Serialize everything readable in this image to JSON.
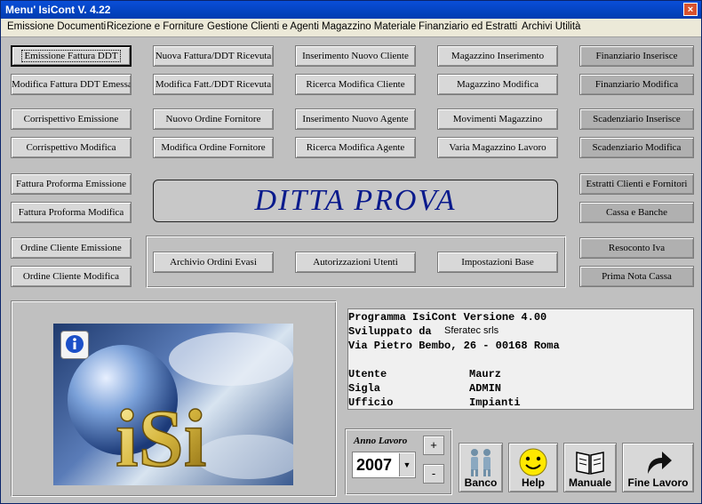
{
  "window": {
    "title": "Menu' IsiCont V. 4.22",
    "close_label": "×"
  },
  "menu": [
    "Emissione Documenti",
    "Ricezione e Forniture",
    "Gestione Clienti e Agenti",
    "Magazzino Materiale",
    "Finanziario ed Estratti",
    "Archivi Utilità"
  ],
  "buttons": {
    "emissione_fattura_ddt": "Emissione Fattura DDT",
    "modifica_fattura_ddt": "Modifica Fattura DDT Emessa",
    "corrispettivo_emissione": "Corrispettivo Emissione",
    "corrispettivo_modifica": "Corrispettivo Modifica",
    "proforma_emissione": "Fattura Proforma Emissione",
    "proforma_modifica": "Fattura Proforma Modifica",
    "ordine_cliente_emissione": "Ordine Cliente Emissione",
    "ordine_cliente_modifica": "Ordine Cliente Modifica",
    "nuova_fattura_ricevuta": "Nuova Fattura/DDT Ricevuta",
    "modifica_fatt_ricevuta": "Modifica Fatt./DDT Ricevuta",
    "nuovo_ordine_fornitore": "Nuovo Ordine Fornitore",
    "modifica_ordine_fornitore": "Modifica Ordine Fornitore",
    "inserimento_cliente": "Inserimento Nuovo Cliente",
    "ricerca_cliente": "Ricerca Modifica Cliente",
    "inserimento_agente": "Inserimento Nuovo Agente",
    "ricerca_agente": "Ricerca Modifica Agente",
    "magazzino_inserimento": "Magazzino Inserimento",
    "magazzino_modifica": "Magazzino Modifica",
    "movimenti_magazzino": "Movimenti Magazzino",
    "varia_magazzino": "Varia Magazzino Lavoro",
    "finanziario_inserisce": "Finanziario Inserisce",
    "finanziario_modifica": "Finanziario Modifica",
    "scadenziario_inserisce": "Scadenziario Inserisce",
    "scadenziario_modifica": "Scadenziario Modifica",
    "estratti": "Estratti Clienti e Fornitori",
    "cassa_banche": "Cassa e Banche",
    "resoconto_iva": "Resoconto Iva",
    "prima_nota": "Prima Nota Cassa",
    "archivio_ordini": "Archivio Ordini Evasi",
    "autorizzazioni": "Autorizzazioni Utenti",
    "impostazioni": "Impostazioni Base"
  },
  "company_name": "DITTA PROVA",
  "info": {
    "program": "Programma IsiCont Versione 4.00",
    "dev_label": "Sviluppato da",
    "dev_value": "Sferatec srls",
    "address": "Via Pietro Bembo, 26 - 00168 Roma",
    "user_label": "Utente",
    "user_value": "Maurz",
    "sigla_label": "Sigla",
    "sigla_value": "ADMIN",
    "office_label": "Ufficio",
    "office_value": "Impianti"
  },
  "year": {
    "label": "Anno Lavoro",
    "value": "2007",
    "plus": "+",
    "minus": "-"
  },
  "logo_text": "iSi",
  "bottom": {
    "banco": "Banco",
    "help": "Help",
    "manuale": "Manuale",
    "fine": "Fine Lavoro"
  }
}
